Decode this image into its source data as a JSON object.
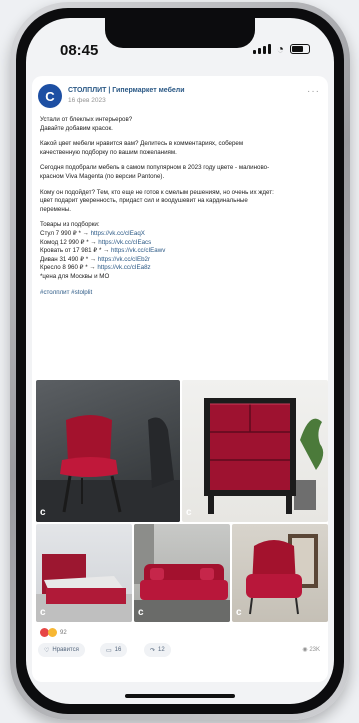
{
  "status": {
    "time": "08:45"
  },
  "post": {
    "author": "СТОЛПЛИТ | Гипермаркет мебели",
    "date": "16 фев 2023",
    "more": "···",
    "paragraphs": [
      [
        "Устали от блеклых интерьеров?",
        "Давайте добавим красок."
      ],
      [
        "Какой цвет мебели нравится вам? Делитесь в комментариях, соберем",
        "качественную подборку по вашим пожеланиям."
      ],
      [
        "Сегодня подобрали мебель в самом популярном в 2023 году цвете - малиново-",
        "красном Viva Magenta (по версии Pantone)."
      ],
      [
        "Кому он подойдет? Тем, кто еще не готов к смелым решениям, но очень их ждет:",
        "цвет подарит уверенность, придаст сил и воодушевит на кардинальные",
        "перемены."
      ]
    ],
    "goods_title": "Товары из подборки:",
    "goods": [
      {
        "prefix": "Стул 7 990 ₽ * → ",
        "link": "https://vk.cc/cIEaqX"
      },
      {
        "prefix": "Комод 12 990 ₽ * → ",
        "link": "https://vk.cc/cIEacs"
      },
      {
        "prefix": "Кровать от 17 981 ₽ * → ",
        "link": "https://vk.cc/cIEawv"
      },
      {
        "prefix": "Диван 31 490 ₽ * → ",
        "link": "https://vk.cc/cIEb2r"
      },
      {
        "prefix": "Кресло 8 960 ₽ * → ",
        "link": "https://vk.cc/cIEa8z"
      }
    ],
    "footnote": "*цена для Москвы и МО",
    "hashtags": "#столплит #stolplit",
    "reaction_count": "92",
    "like_label": "Нравится",
    "comments_count": "16",
    "shares_count": "12",
    "views": "23K"
  },
  "colors": {
    "magenta": "#b3183a",
    "link": "#2a5885",
    "brand": "#1d4fa3"
  },
  "icons": {
    "like": "heart-outline-icon",
    "comment": "comment-icon",
    "share": "share-icon",
    "views": "eye-icon"
  }
}
